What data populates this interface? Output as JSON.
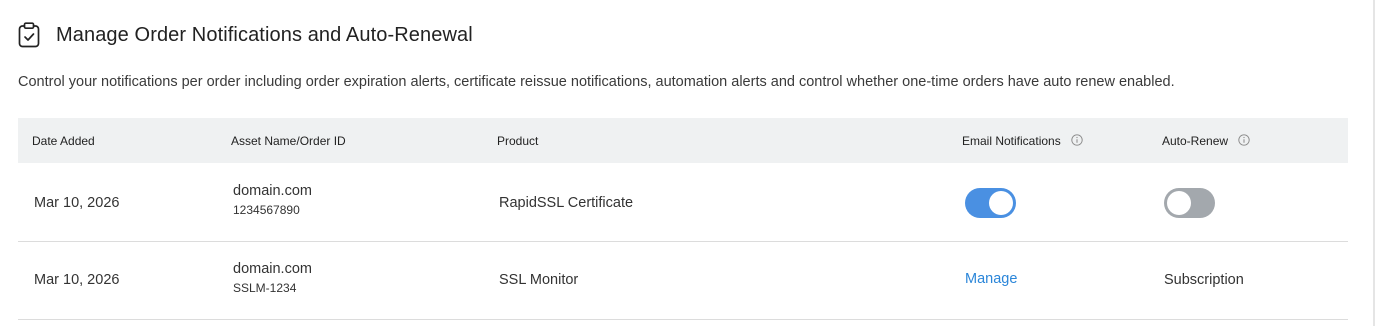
{
  "header": {
    "title": "Manage Order Notifications and Auto-Renewal",
    "icon": "clipboard-check-icon"
  },
  "description": "Control your notifications per order including order expiration alerts, certificate reissue notifications, automation alerts and control whether one-time orders have auto renew enabled.",
  "table": {
    "columns": {
      "date_added": "Date Added",
      "asset": "Asset Name/Order ID",
      "product": "Product",
      "email_notifications": "Email Notifications",
      "auto_renew": "Auto-Renew"
    },
    "rows": [
      {
        "date_added": "Mar 10, 2026",
        "asset_name": "domain.com",
        "order_id": "1234567890",
        "product": "RapidSSL Certificate",
        "email_notifications": "on",
        "auto_renew": "off"
      },
      {
        "date_added": "Mar 10, 2026",
        "asset_name": "domain.com",
        "order_id": "SSLM-1234",
        "product": "SSL Monitor",
        "email_notifications_link": "Manage",
        "auto_renew_text": "Subscription"
      }
    ]
  },
  "colors": {
    "toggle_on": "#4a90e2",
    "toggle_off": "#a3a8ad",
    "link": "#2b86d9",
    "header_bg": "#eff1f2"
  }
}
